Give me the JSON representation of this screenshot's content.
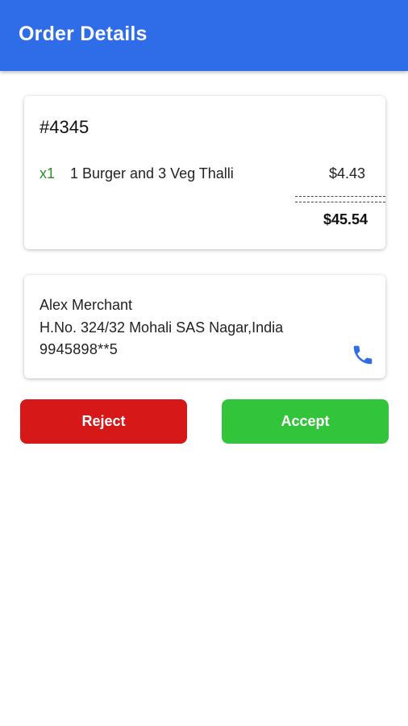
{
  "header": {
    "title": "Order Details"
  },
  "order": {
    "id": "#4345",
    "item": {
      "qty": "x1",
      "name": "1 Burger and 3 Veg Thalli",
      "price": "$4.43"
    },
    "total": "$45.54"
  },
  "customer": {
    "name": "Alex Merchant",
    "address": "H.No. 324/32 Mohali SAS Nagar,India",
    "phone": "9945898**5"
  },
  "actions": {
    "reject_label": "Reject",
    "accept_label": "Accept"
  },
  "colors": {
    "app_bar": "#2f6de8",
    "reject": "#d71818",
    "accept": "#32c43a",
    "qty_text": "#2e8b2e",
    "phone_icon": "#2f6de8"
  },
  "icons": {
    "call": "phone-icon"
  }
}
